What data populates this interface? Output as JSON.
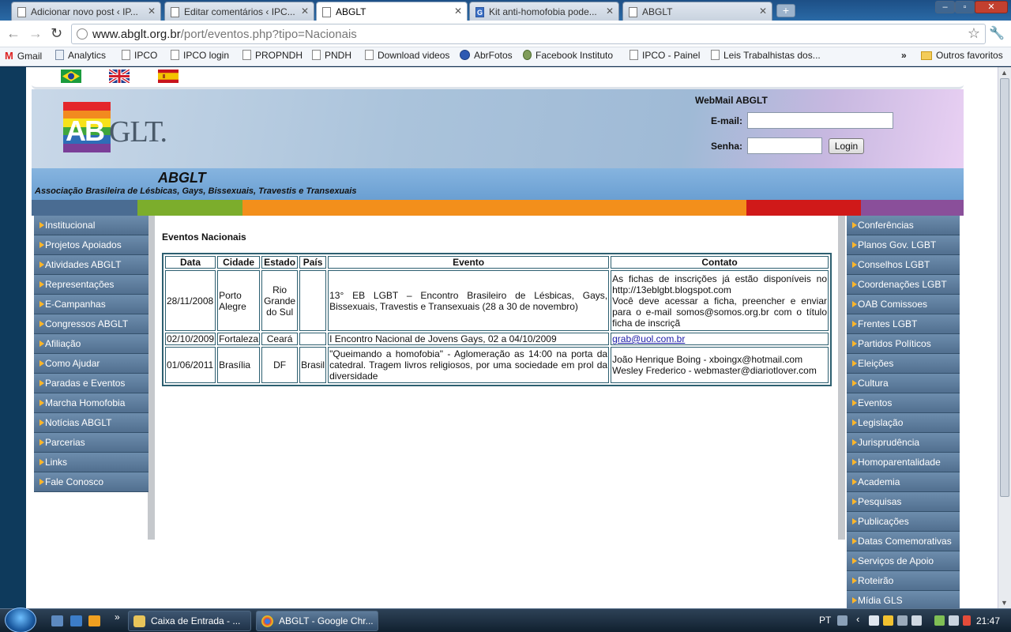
{
  "browser": {
    "tabs": [
      {
        "title": "Adicionar novo post ‹ IP...",
        "icon": "page-icon",
        "active": false
      },
      {
        "title": "Editar comentários ‹ IPC...",
        "icon": "page-icon",
        "active": false
      },
      {
        "title": "ABGLT",
        "icon": "page-icon",
        "active": true
      },
      {
        "title": "Kit anti-homofobia pode...",
        "icon": "google-icon",
        "active": false
      },
      {
        "title": "ABGLT",
        "icon": "page-icon",
        "active": false
      }
    ],
    "url_host": "www.abglt.org.br",
    "url_path": "/port/eventos.php?tipo=Nacionais",
    "bookmarks": [
      {
        "label": "Gmail",
        "icon": "gmail-icon"
      },
      {
        "label": "Analytics",
        "icon": "analytics-icon"
      },
      {
        "label": "IPCO",
        "icon": "page-icon"
      },
      {
        "label": "IPCO login",
        "icon": "page-icon"
      },
      {
        "label": "PROPNDH",
        "icon": "page-icon"
      },
      {
        "label": "PNDH",
        "icon": "page-icon"
      },
      {
        "label": "Download videos",
        "icon": "page-icon"
      },
      {
        "label": "AbrFotos",
        "icon": "abr-icon"
      },
      {
        "label": "Facebook Instituto",
        "icon": "facebook-icon"
      },
      {
        "label": "IPCO - Painel",
        "icon": "page-icon"
      },
      {
        "label": "Leis Trabalhistas dos...",
        "icon": "page-icon"
      }
    ],
    "bookmarks_overflow": "»",
    "other_bookmarks": "Outros favoritos"
  },
  "header": {
    "logo_ab": "AB",
    "logo_rest": "GLT.",
    "webmail_title": "WebMail ABGLT",
    "email_label": "E-mail:",
    "password_label": "Senha:",
    "login_button": "Login",
    "org_name": "ABGLT",
    "org_fullname": "Associação Brasileira de Lésbicas, Gays, Bissexuais, Travestis e Transexuais"
  },
  "colorbar": [
    "#4a6c92",
    "#7cad2c",
    "#f38f1b",
    "#d01919",
    "#8a4f9a"
  ],
  "left_menu": [
    "Institucional",
    "Projetos Apoiados",
    "Atividades ABGLT",
    "Representações",
    "E-Campanhas",
    "Congressos ABGLT",
    "Afiliação",
    "Como Ajudar",
    "Paradas e Eventos",
    "Marcha Homofobia",
    "Notícias ABGLT",
    "Parcerias",
    "Links",
    "Fale Conosco"
  ],
  "right_menu": [
    "Conferências",
    "Planos Gov. LGBT",
    "Conselhos LGBT",
    "Coordenações LGBT",
    "OAB Comissoes",
    "Frentes LGBT",
    "Partidos Políticos",
    "Eleições",
    "Cultura",
    "Eventos",
    "Legislação",
    "Jurisprudência",
    "Homoparentalidade",
    "Academia",
    "Pesquisas",
    "Publicações",
    "Datas Comemorativas",
    "Serviços de Apoio",
    "Roteirão",
    "Mídia GLS"
  ],
  "content": {
    "title": "Eventos Nacionais",
    "columns": [
      "Data",
      "Cidade",
      "Estado",
      "País",
      "Evento",
      "Contato"
    ],
    "rows": [
      {
        "data": "28/11/2008",
        "cidade": "Porto Alegre",
        "estado": "Rio Grande do Sul",
        "pais": "",
        "evento": "13° EB LGBT – Encontro Brasileiro de Lésbicas, Gays, Bissexuais, Travestis e Transexuais (28 a 30 de novembro)",
        "contato": "As fichas de inscrições já estão disponíveis no http://13eblgbt.blogspot.com\nVocê deve acessar a ficha, preencher e enviar para o e-mail somos@somos.org.br com o título ficha de inscriçã"
      },
      {
        "data": "02/10/2009",
        "cidade": "Fortaleza",
        "estado": "Ceará",
        "pais": "",
        "evento": "I Encontro Nacional de Jovens Gays, 02 a 04/10/2009",
        "contato_link": "grab@uol.com.br"
      },
      {
        "data": "01/06/2011",
        "cidade": "Brasília",
        "estado": "DF",
        "pais": "Brasil",
        "evento": "\"Queimando a homofobia\" - Aglomeração as 14:00 na porta da catedral. Tragem livros religiosos, por uma sociedade em prol da diversidade",
        "contato": "João Henrique Boing - xboingx@hotmail.com\nWesley Frederico - webmaster@diariotlover.com"
      }
    ]
  },
  "taskbar": {
    "items": [
      {
        "label": "Caixa de Entrada - ...",
        "icon": "mail-icon"
      },
      {
        "label": "ABGLT - Google Chr...",
        "icon": "chrome-icon"
      }
    ],
    "language": "PT",
    "time": "21:47"
  }
}
